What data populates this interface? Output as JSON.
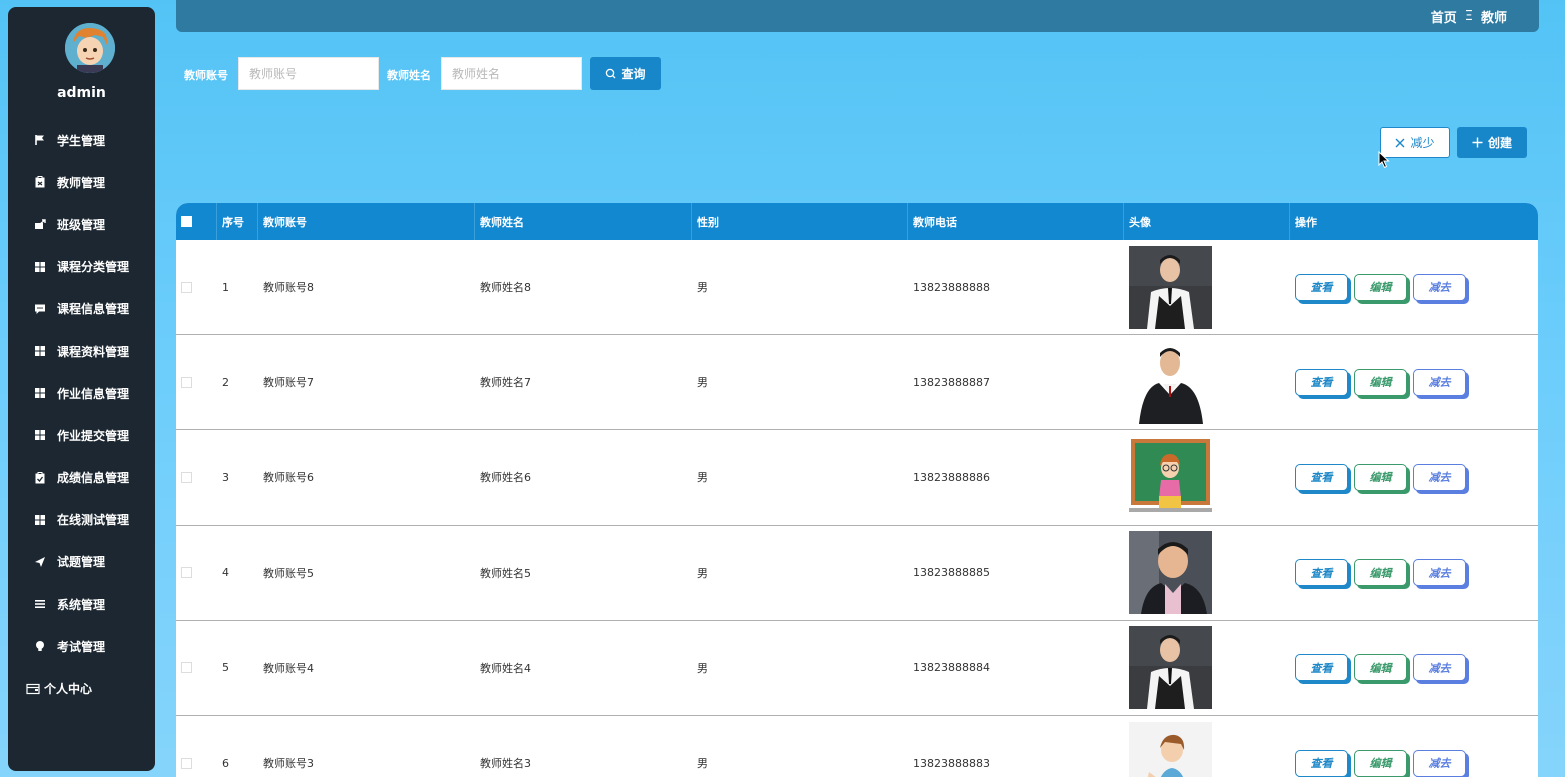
{
  "user": {
    "name": "admin"
  },
  "sidebar": {
    "items": [
      {
        "label": "学生管理",
        "icon": "flag-icon"
      },
      {
        "label": "教师管理",
        "icon": "clipboard-icon"
      },
      {
        "label": "班级管理",
        "icon": "share-icon"
      },
      {
        "label": "课程分类管理",
        "icon": "grid-icon"
      },
      {
        "label": "课程信息管理",
        "icon": "chat-icon"
      },
      {
        "label": "课程资料管理",
        "icon": "grid-icon"
      },
      {
        "label": "作业信息管理",
        "icon": "grid-icon"
      },
      {
        "label": "作业提交管理",
        "icon": "grid-icon"
      },
      {
        "label": "成绩信息管理",
        "icon": "clipboard-check-icon"
      },
      {
        "label": "在线测试管理",
        "icon": "grid-icon"
      },
      {
        "label": "试题管理",
        "icon": "send-icon"
      },
      {
        "label": "系统管理",
        "icon": "list-icon"
      },
      {
        "label": "考试管理",
        "icon": "bulb-icon"
      },
      {
        "label": "个人中心",
        "icon": "wallet-icon"
      }
    ]
  },
  "breadcrumb": {
    "home": "首页",
    "separator": "Ξ",
    "current": "教师"
  },
  "search": {
    "account_label": "教师账号",
    "account_placeholder": "教师账号",
    "name_label": "教师姓名",
    "name_placeholder": "教师姓名",
    "query_button": "查询"
  },
  "actions": {
    "reduce_label": "减少",
    "create_label": "创建"
  },
  "table": {
    "headers": [
      "序号",
      "教师账号",
      "教师姓名",
      "性别",
      "教师电话",
      "头像",
      "操作"
    ],
    "op_labels": {
      "view": "查看",
      "edit": "编辑",
      "delete": "减去"
    },
    "rows": [
      {
        "no": "1",
        "account": "教师账号8",
        "name": "教师姓名8",
        "gender": "男",
        "phone": "13823888888",
        "photo": "man-suit-icon"
      },
      {
        "no": "2",
        "account": "教师账号7",
        "name": "教师姓名7",
        "gender": "男",
        "phone": "13823888887",
        "photo": "man-suit-icon"
      },
      {
        "no": "3",
        "account": "教师账号6",
        "name": "教师姓名6",
        "gender": "男",
        "phone": "13823888886",
        "photo": "teacher-cartoon-icon"
      },
      {
        "no": "4",
        "account": "教师账号5",
        "name": "教师姓名5",
        "gender": "男",
        "phone": "13823888885",
        "photo": "man-portrait-icon"
      },
      {
        "no": "5",
        "account": "教师账号4",
        "name": "教师姓名4",
        "gender": "男",
        "phone": "13823888884",
        "photo": "man-suit-icon"
      },
      {
        "no": "6",
        "account": "教师账号3",
        "name": "教师姓名3",
        "gender": "男",
        "phone": "13823888883",
        "photo": "woman-cartoon-icon"
      }
    ]
  }
}
